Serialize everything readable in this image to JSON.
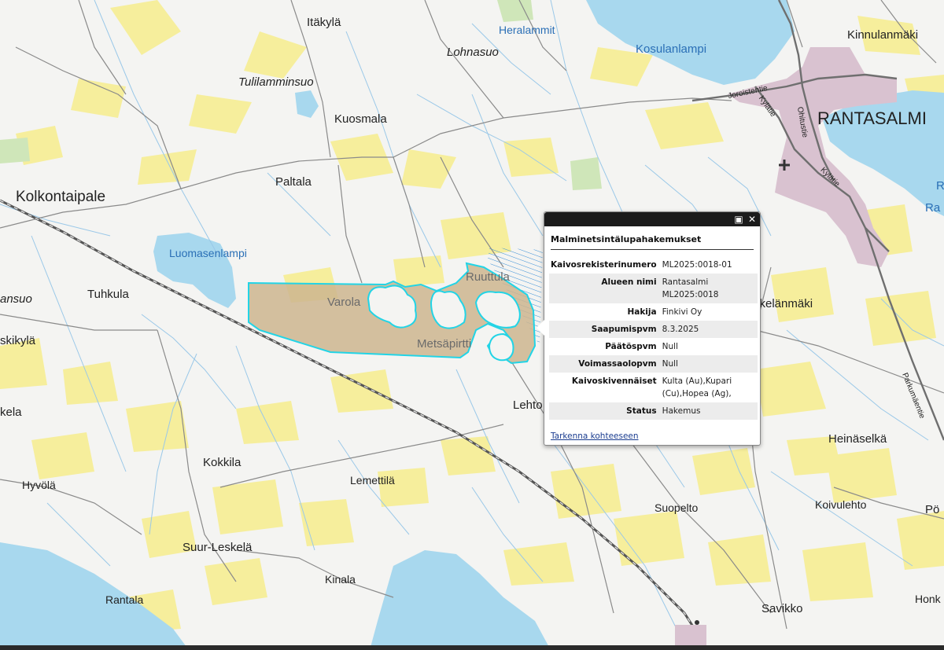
{
  "places": {
    "itakyla": "Itäkylä",
    "heralammit": "Heralammit",
    "lohnasuo": "Lohnasuo",
    "kosulanlampi": "Kosulanlampi",
    "kinnulanmaki": "Kinnulanmäki",
    "tulilamminsuo": "Tulilamminsuo",
    "kuosmala": "Kuosmala",
    "rantasalmi": "RANTASALMI",
    "kolkontaipale": "Kolkontaipale",
    "paltala": "Paltala",
    "luomasenlampi": "Luomasenlampi",
    "ruuttula": "Ruuttula",
    "varola": "Varola",
    "metsapirtti": "Metsäpirtti",
    "tuhkula": "Tuhkula",
    "ansuo": "ansuo",
    "skikyla": "skikylä",
    "kela": "kela",
    "lehto": "Lehto",
    "kokkila": "Kokkila",
    "lemettila": "Lemettilä",
    "hyvola": "Hyvölä",
    "suopelto": "Suopelto",
    "koivulehto": "Koivulehto",
    "suurleskela": "Suur-Leskelä",
    "kinala": "Kinala",
    "rantala": "Rantala",
    "savikko": "Savikko",
    "honk": "Honk",
    "po": "Pö",
    "heinaselka": "Heinäselkä",
    "skelanmaki": "skelänmäki",
    "r_cut": "R",
    "ra_cut": "Ra"
  },
  "roads": {
    "joroistentie": "Joroistentie",
    "kylatie1": "Kylätie",
    "ohitustie": "Ohitustie",
    "kylatie2": "Kylätie",
    "parkumaentie": "Parkumäentie"
  },
  "popup": {
    "title": "Malminetsintälupahakemukset",
    "rows": [
      {
        "key": "Kaivosrekisterinumero",
        "value": "ML2025:0018-01"
      },
      {
        "key": "Alueen nimi",
        "value": "Rantasalmi ML2025:0018"
      },
      {
        "key": "Hakija",
        "value": "Finkivi Oy"
      },
      {
        "key": "Saapumispvm",
        "value": "8.3.2025"
      },
      {
        "key": "Päätöspvm",
        "value": "Null"
      },
      {
        "key": "Voimassaolopvm",
        "value": "Null"
      },
      {
        "key": "Kaivoskivennäiset",
        "value": "Kulta (Au),Kupari (Cu),Hopea (Ag),"
      },
      {
        "key": "Status",
        "value": "Hakemus"
      }
    ],
    "link": "Tarkenna kohteeseen",
    "maximize_icon": "maximize-icon",
    "close_icon": "close-icon"
  },
  "colors": {
    "water": "#a8d8ee",
    "field": "#f6ee9c",
    "urban": "#d9c2d0",
    "claim_fill": "#cdb58f",
    "claim_outline": "#22d4e6",
    "road": "#8a8a8a",
    "stream": "#9ac8e8"
  }
}
